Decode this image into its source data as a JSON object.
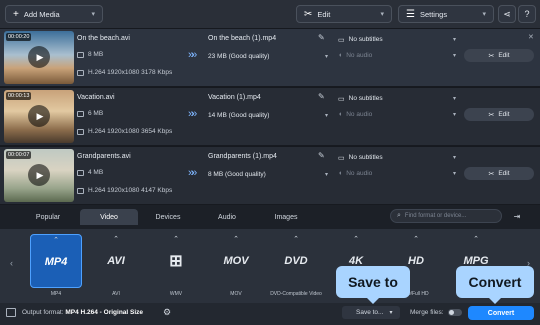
{
  "toolbar": {
    "add_media": "Add Media",
    "edit": "Edit",
    "settings": "Settings"
  },
  "files": [
    {
      "duration": "00:00:20",
      "name": "On the beach.avi",
      "size": "8 MB",
      "info": "H.264 1920x1080 3178 Kbps",
      "output_name": "On the beach (1).mp4",
      "output_size": "23 MB (Good quality)",
      "subtitles": "No subtitles",
      "audio": "No audio",
      "edit": "Edit"
    },
    {
      "duration": "00:00:13",
      "name": "Vacation.avi",
      "size": "6 MB",
      "info": "H.264 1920x1080 3654 Kbps",
      "output_name": "Vacation (1).mp4",
      "output_size": "14 MB (Good quality)",
      "subtitles": "No subtitles",
      "audio": "No audio",
      "edit": "Edit"
    },
    {
      "duration": "00:00:07",
      "name": "Grandparents.avi",
      "size": "4 MB",
      "info": "H.264 1920x1080 4147 Kbps",
      "output_name": "Grandparents (1).mp4",
      "output_size": "8 MB (Good quality)",
      "subtitles": "No subtitles",
      "audio": "No audio",
      "edit": "Edit"
    }
  ],
  "format_tabs": [
    "Popular",
    "Video",
    "Devices",
    "Audio",
    "Images"
  ],
  "active_tab": "Video",
  "format_search": {
    "placeholder": "Find format or device..."
  },
  "formats": [
    {
      "badge": "MP4",
      "label": "MP4"
    },
    {
      "badge": "AVI",
      "label": "AVI"
    },
    {
      "badge": "WMV",
      "label": "WMV"
    },
    {
      "badge": "MOV",
      "label": "MOV"
    },
    {
      "badge": "DVD",
      "label": "DVD-Compatible Video"
    },
    {
      "badge": "4K",
      "label": "4K Ultra HD"
    },
    {
      "badge": "HD",
      "label": "HD/Full HD"
    },
    {
      "badge": "MPG",
      "label": "MPEG-1"
    }
  ],
  "bottom": {
    "output_label": "Output format:",
    "output_value": "MP4 H.264 - Original Size",
    "save_to": "Save to...",
    "merge_files": "Merge files:",
    "convert": "Convert"
  },
  "tooltips": {
    "save_to": "Save to",
    "convert": "Convert"
  },
  "colors": {
    "accent": "#1e88ff",
    "tooltip": "#a9d4ff"
  }
}
